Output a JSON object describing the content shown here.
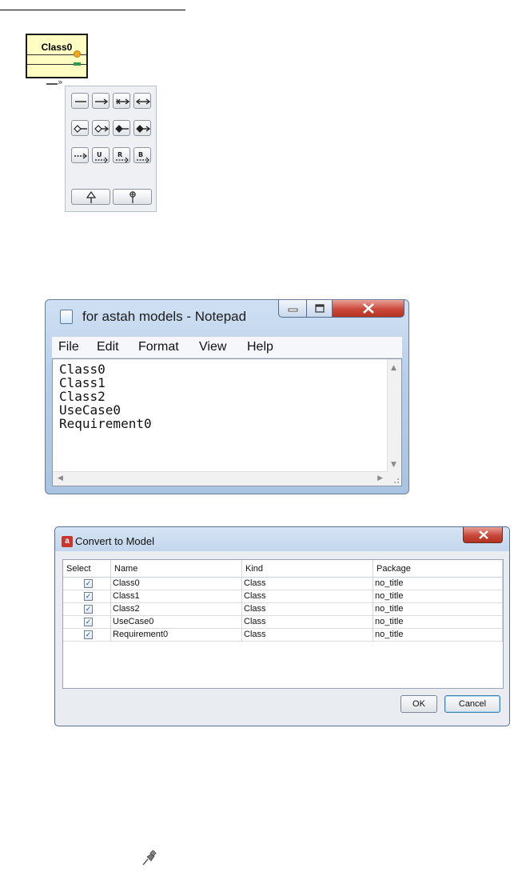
{
  "uml_class": {
    "name": "Class0"
  },
  "notepad": {
    "title": "for astah models - Notepad",
    "menu": [
      "File",
      "Edit",
      "Format",
      "View",
      "Help"
    ],
    "lines": [
      "Class0",
      "Class1",
      "Class2",
      "UseCase0",
      "Requirement0"
    ]
  },
  "dialog": {
    "title": "Convert to Model",
    "columns": [
      "Select",
      "Name",
      "Kind",
      "Package"
    ],
    "rows": [
      {
        "name": "Class0",
        "kind": "Class",
        "package": "no_title",
        "checked": true
      },
      {
        "name": "Class1",
        "kind": "Class",
        "package": "no_title",
        "checked": true
      },
      {
        "name": "Class2",
        "kind": "Class",
        "package": "no_title",
        "checked": true
      },
      {
        "name": "UseCase0",
        "kind": "Class",
        "package": "no_title",
        "checked": true
      },
      {
        "name": "Requirement0",
        "kind": "Class",
        "package": "no_title",
        "checked": true
      }
    ],
    "ok_label": "OK",
    "cancel_label": "Cancel"
  },
  "icons": {
    "notepad": "notepad-icon",
    "dialog": "astah-icon",
    "pin": "pushpin-icon"
  }
}
